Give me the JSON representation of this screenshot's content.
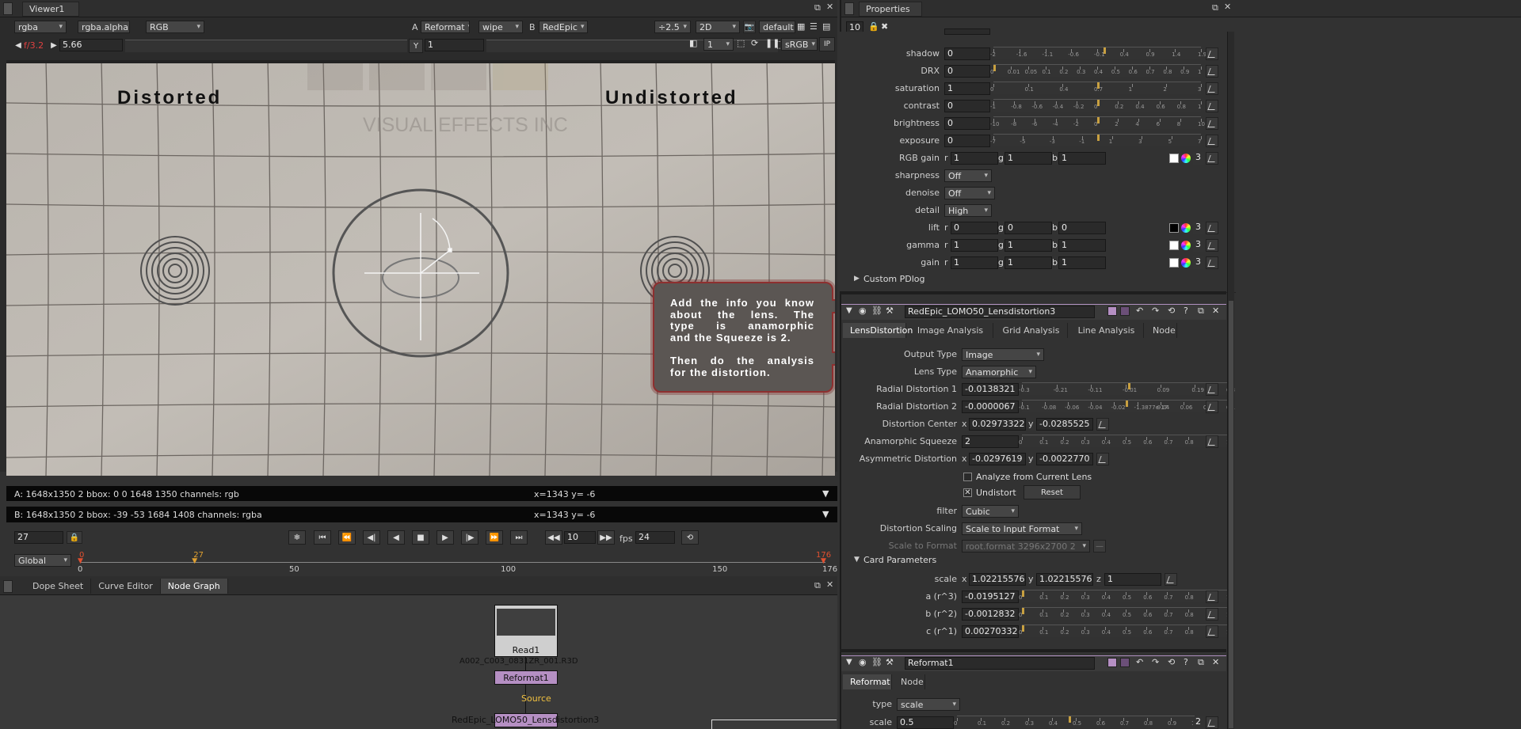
{
  "viewer": {
    "title": "Viewer1",
    "channels": "rgba",
    "alpha": "rgba.alpha",
    "colorspace": "RGB",
    "a_label": "A",
    "a_input": "Reformat",
    "wipe": "wipe",
    "b_label": "B",
    "b_input": "RedEpic",
    "zoom": "÷2.5",
    "mode": "2D",
    "lut_set": "default",
    "fstop": "f/3.2",
    "gain_value": "5.66",
    "gamma_label": "Y",
    "gamma_value": "1",
    "proxy": "1",
    "display": "sRGB",
    "ip": "IP",
    "overlay_left": "Distorted",
    "overlay_right": "Undistorted",
    "info_a": "A:  1648x1350 2 bbox: 0 0 1648 1350 channels: rgb",
    "coords_a": "x=1343 y=  -6",
    "info_b": "B:  1648x1350 2 bbox: -39 -53 1684 1408 channels: rgba",
    "coords_b": "x=1343 y=  -6",
    "watermark": "VISUAL EFFECTS INC",
    "callout": [
      "Add the info you know",
      "about the lens. The",
      "type is anamorphic",
      "and the Squeeze is 2.",
      "",
      "Then do the analysis",
      "for the distortion."
    ]
  },
  "timeline": {
    "frame": "27",
    "step": "10",
    "fps_label": "fps",
    "fps": "24",
    "scope": "Global",
    "ticks": [
      "0",
      "50",
      "100",
      "150",
      "176"
    ],
    "marker_in": "0",
    "marker_current": "27",
    "marker_out": "176"
  },
  "lower": {
    "tabs": [
      "Dope Sheet",
      "Curve Editor",
      "Node Graph"
    ],
    "nodes": {
      "read": "Read1",
      "read_file": "A002_C003_0831ZR_001.R3D",
      "reformat": "Reformat1",
      "source_label": "Source",
      "lens": "RedEpic_LOMO50_Lensdistortion3"
    }
  },
  "properties": {
    "title": "Properties",
    "count": "10",
    "read_rows": [
      {
        "label": "shadow",
        "value": "0",
        "ticks": [
          "-2",
          "-1.6",
          "-1.1",
          "-0.6",
          "-0.1",
          "0.4",
          "0.9",
          "1.4",
          "1.9"
        ],
        "mark": 0.53
      },
      {
        "label": "DRX",
        "value": "0",
        "ticks": [
          "0",
          "0.01",
          "0.05",
          "0.1",
          "0.2",
          "0.3",
          "0.4",
          "0.5",
          "0.6",
          "0.7",
          "0.8",
          "0.9",
          "1"
        ],
        "mark": 0.0
      },
      {
        "label": "saturation",
        "value": "1",
        "ticks": [
          "0",
          "0.1",
          "0.4",
          "0.7",
          "1",
          "2",
          "3"
        ],
        "mark": 0.5
      },
      {
        "label": "contrast",
        "value": "0",
        "ticks": [
          "-1",
          "-0.8",
          "-0.6",
          "-0.4",
          "-0.2",
          "0",
          "0.2",
          "0.4",
          "0.6",
          "0.8",
          "1"
        ],
        "mark": 0.5
      },
      {
        "label": "brightness",
        "value": "0",
        "ticks": [
          "-10",
          "-8",
          "-6",
          "-4",
          "-2",
          "0",
          "2",
          "4",
          "6",
          "8",
          "10"
        ],
        "mark": 0.5
      },
      {
        "label": "exposure",
        "value": "0",
        "ticks": [
          "-7",
          "-5",
          "-3",
          "-1",
          "1",
          "3",
          "5",
          "7"
        ],
        "mark": 0.5
      }
    ],
    "rgb_gain": {
      "label": "RGB gain",
      "r": "1",
      "g": "1",
      "b": "1",
      "n": "3"
    },
    "sharpness": {
      "label": "sharpness",
      "value": "Off"
    },
    "denoise": {
      "label": "denoise",
      "value": "Off"
    },
    "detail": {
      "label": "detail",
      "value": "High"
    },
    "lift": {
      "label": "lift",
      "r": "0",
      "g": "0",
      "b": "0",
      "n": "3"
    },
    "gamma": {
      "label": "gamma",
      "r": "1",
      "g": "1",
      "b": "1",
      "n": "3"
    },
    "gain": {
      "label": "gain",
      "r": "1",
      "g": "1",
      "b": "1",
      "n": "3"
    },
    "custom_pdlog": "Custom PDlog",
    "lens": {
      "name": "RedEpic_LOMO50_Lensdistortion3",
      "tabs": [
        "LensDistortion",
        "Image Analysis",
        "Grid Analysis",
        "Line Analysis",
        "Node"
      ],
      "output_type": {
        "label": "Output Type",
        "value": "Image"
      },
      "lens_type": {
        "label": "Lens Type",
        "value": "Anamorphic"
      },
      "rd1": {
        "label": "Radial Distortion 1",
        "value": "-0.0138321",
        "ticks": [
          "-0.3",
          "-0.21",
          "-0.11",
          "-0.01",
          "0.09",
          "0.19",
          "0.3"
        ],
        "mark": 0.51
      },
      "rd2": {
        "label": "Radial Distortion 2",
        "value": "-0.0000067",
        "ticks": [
          "-0.1",
          "-0.08",
          "-0.06",
          "-0.04",
          "-0.02",
          "-1.3877e-17",
          "0.04",
          "0.06",
          "0.08",
          "0.1"
        ],
        "mark": 0.5
      },
      "center": {
        "label": "Distortion Center",
        "x": "0.02973322",
        "y": "-0.0285525"
      },
      "squeeze": {
        "label": "Anamorphic Squeeze",
        "value": "2",
        "ticks": [
          "0",
          "0.1",
          "0.2",
          "0.3",
          "0.4",
          "0.5",
          "0.6",
          "0.7",
          "0.8",
          "0.9",
          "1"
        ],
        "mark": 0.99
      },
      "asym": {
        "label": "Asymmetric Distortion",
        "x": "-0.0297619",
        "y": "-0.0022770"
      },
      "analyze": "Analyze from Current Lens",
      "undistort": "Undistort",
      "reset": "Reset",
      "filter": {
        "label": "filter",
        "value": "Cubic"
      },
      "scaling": {
        "label": "Distortion Scaling",
        "value": "Scale to Input Format"
      },
      "scale_to": {
        "label": "Scale to Format",
        "value": "root.format 3296x2700 2"
      },
      "card": "Card Parameters",
      "scale": {
        "label": "scale",
        "x": "1.02215576",
        "y": "1.02215576",
        "z": "1"
      },
      "a": {
        "label": "a (r^3)",
        "value": "-0.0195127"
      },
      "b": {
        "label": "b (r^2)",
        "value": "-0.0012832"
      },
      "c": {
        "label": "c (r^1)",
        "value": "0.00270332"
      },
      "card_ticks": [
        "0",
        "0.1",
        "0.2",
        "0.3",
        "0.4",
        "0.5",
        "0.6",
        "0.7",
        "0.8",
        "0.9",
        "1"
      ]
    },
    "reformat": {
      "name": "Reformat1",
      "tabs": [
        "Reformat",
        "Node"
      ],
      "type": {
        "label": "type",
        "value": "scale"
      },
      "scale": {
        "label": "scale",
        "value": "0.5",
        "n": "2"
      }
    }
  }
}
